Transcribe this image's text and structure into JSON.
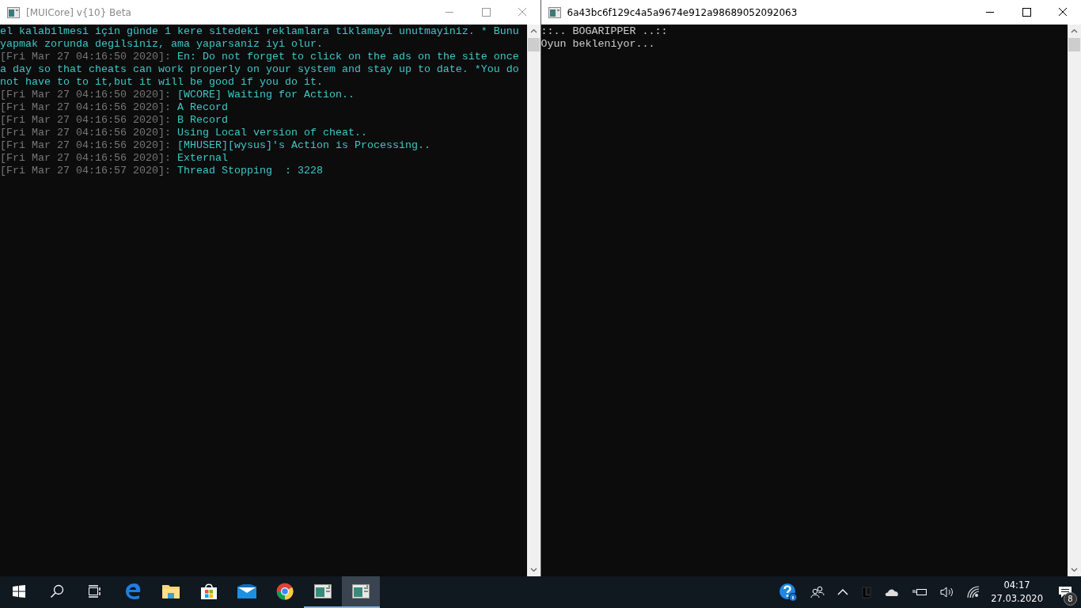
{
  "windows": [
    {
      "title": "[MUICore] v{10} Beta",
      "active": false,
      "lines": [
        {
          "message": "el kalabilmesi için günde 1 kere sitedeki reklamlara tiklamayi unutmayiniz. * Bunu yapmak zorunda degilsiniz, ama yaparsaniz iyi olur."
        },
        {
          "timestamp": "[Fri Mar 27 04:16:50 2020]: ",
          "message": "En: Do not forget to click on the ads on the site once a day so that cheats can work properly on your system and stay up to date. *You do not have to to it,but it will be good if you do it."
        },
        {
          "timestamp": "[Fri Mar 27 04:16:50 2020]: ",
          "message": "[WCORE] Waiting for Action.."
        },
        {
          "timestamp": "[Fri Mar 27 04:16:56 2020]: ",
          "message": "A Record"
        },
        {
          "timestamp": "[Fri Mar 27 04:16:56 2020]: ",
          "message": "B Record"
        },
        {
          "timestamp": "[Fri Mar 27 04:16:56 2020]: ",
          "message": "Using Local version of cheat.."
        },
        {
          "timestamp": "[Fri Mar 27 04:16:56 2020]: ",
          "message": "[MHUSER][wysus]'s Action is Processing.."
        },
        {
          "timestamp": "[Fri Mar 27 04:16:56 2020]: ",
          "message": "External"
        },
        {
          "timestamp": "[Fri Mar 27 04:16:57 2020]: ",
          "message": "Thread Stopping  : 3228"
        }
      ]
    },
    {
      "title": "6a43bc6f129c4a5a9674e912a98689052092063",
      "active": true,
      "lines": [
        {
          "message": "::.. BOGARIPPER ..::"
        },
        {
          "message": "Oyun bekleniyor..."
        }
      ]
    }
  ],
  "taskbar": {
    "apps": [
      {
        "kind": "start"
      },
      {
        "kind": "search"
      },
      {
        "kind": "taskview"
      },
      {
        "kind": "edge",
        "running": false,
        "selected": false
      },
      {
        "kind": "explorer",
        "running": false,
        "selected": false
      },
      {
        "kind": "store",
        "running": false,
        "selected": false
      },
      {
        "kind": "mail",
        "running": false,
        "selected": false
      },
      {
        "kind": "chrome",
        "running": false,
        "selected": false
      },
      {
        "kind": "console",
        "running": true,
        "selected": false
      },
      {
        "kind": "console",
        "running": true,
        "selected": true
      }
    ],
    "clock": {
      "time": "04:17",
      "date": "27.03.2020"
    },
    "notifications": {
      "count": "8"
    }
  }
}
